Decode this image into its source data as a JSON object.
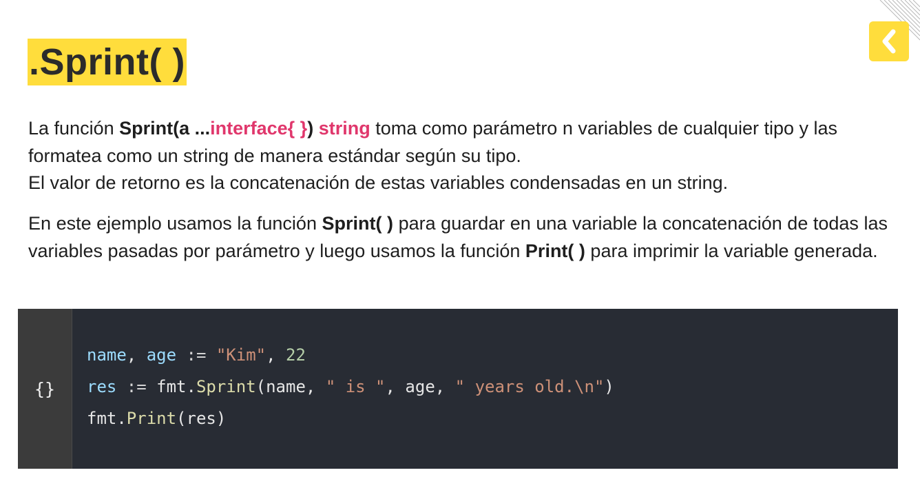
{
  "header": {
    "title": ".Sprint( )",
    "back_icon": "chevron-left-icon",
    "accent": "#ffdd3c"
  },
  "paragraph1": {
    "intro": "La función ",
    "sig_a": "Sprint(a ...",
    "sig_b": "interface{ }",
    "sig_c": ")",
    "sig_d": " string",
    "rest": " toma como parámetro n variables de cualquier tipo y las formatea como un string de manera estándar según su tipo.",
    "line3": "El valor de retorno es la concatenación de estas variables condensadas en un string."
  },
  "paragraph2": {
    "intro": "En este ejemplo usamos la función ",
    "sprint": "Sprint( )",
    "mid": " para guardar en una variable la concatenación de todas las variables pasadas por parámetro y luego usamos la función ",
    "print": "Print( )",
    "end": " para imprimir la variable generada."
  },
  "code": {
    "gutter_icon": "{}",
    "lines": [
      [
        {
          "t": "name",
          "c": "var"
        },
        {
          "t": ", ",
          "c": "plain"
        },
        {
          "t": "age",
          "c": "var"
        },
        {
          "t": " := ",
          "c": "op"
        },
        {
          "t": "\"Kim\"",
          "c": "str"
        },
        {
          "t": ", ",
          "c": "plain"
        },
        {
          "t": "22",
          "c": "num"
        }
      ],
      [
        {
          "t": "res",
          "c": "var"
        },
        {
          "t": " := ",
          "c": "op"
        },
        {
          "t": "fmt.",
          "c": "plain"
        },
        {
          "t": "Sprint",
          "c": "fn"
        },
        {
          "t": "(name, ",
          "c": "plain"
        },
        {
          "t": "\" is \"",
          "c": "str"
        },
        {
          "t": ", age, ",
          "c": "plain"
        },
        {
          "t": "\" years old.\\n\"",
          "c": "str"
        },
        {
          "t": ")",
          "c": "plain"
        }
      ],
      [
        {
          "t": "fmt.",
          "c": "plain"
        },
        {
          "t": "Print",
          "c": "fn"
        },
        {
          "t": "(res)",
          "c": "plain"
        }
      ]
    ]
  }
}
